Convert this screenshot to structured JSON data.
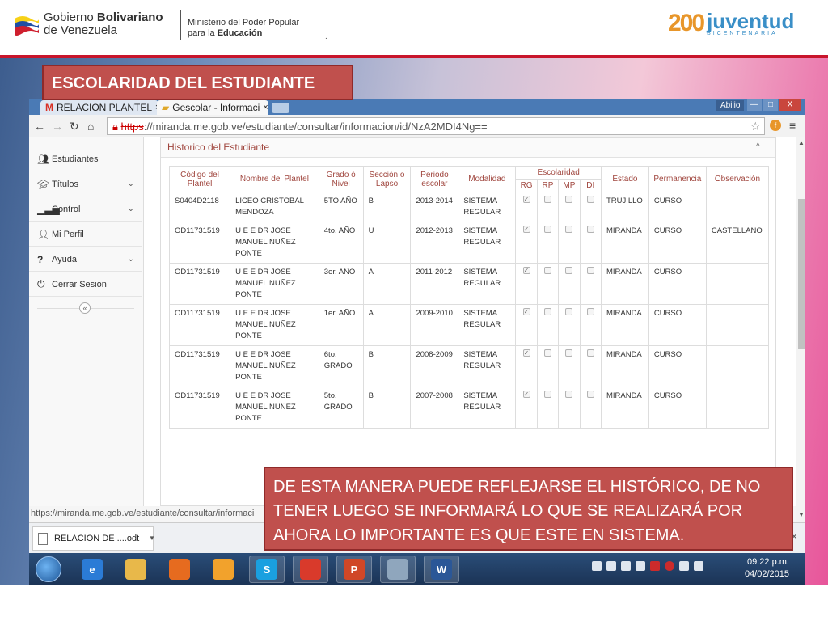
{
  "slide": {
    "title": "ESCOLARIDAD DEL ESTUDIANTE",
    "gov_title_bold": "Bolivariano",
    "gov_title_pre": "Gobierno",
    "gov_title_line2": "de Venezuela",
    "ministry_line1": "Ministerio  del Poder Popular",
    "ministry_line2_pre": "para la",
    "ministry_line2_bold": "Educación",
    "ministry_dot": ".",
    "youth_number": "200",
    "youth_word": "juventud",
    "youth_sub": "BICENTENARIA",
    "callout": "DE ESTA MANERA PUEDE REFLEJARSE EL HISTÓRICO, DE NO TENER LUEGO SE INFORMARÁ LO QUE SE REALIZARÁ POR AHORA LO IMPORTANTE ES QUE ESTE EN SISTEMA."
  },
  "browser": {
    "tabs": [
      {
        "label": "RELACION PLANTEL",
        "close": "×"
      },
      {
        "label": "Gescolar - Informaci",
        "close": "×"
      }
    ],
    "user": "Abilio",
    "window_buttons": [
      "—",
      "□",
      "X"
    ],
    "url_scheme": "https",
    "url_rest": "://miranda.me.gob.ve/estudiante/consultar/informacion/id/NzA2MDI4Ng==",
    "status_text": "https://miranda.me.gob.ve/estudiante/consultar/informaci",
    "download_file": "RELACION DE ....odt"
  },
  "sidebar": {
    "items": [
      {
        "label": "Estudiantes",
        "icon": "users-icon",
        "has_submenu": false
      },
      {
        "label": "Títulos",
        "icon": "graduation-cap-icon",
        "has_submenu": true
      },
      {
        "label": "Control",
        "icon": "signal-bars-icon",
        "has_submenu": true
      },
      {
        "label": "Mi Perfil",
        "icon": "user-icon",
        "has_submenu": false
      },
      {
        "label": "Ayuda",
        "icon": "question-icon",
        "has_submenu": true
      },
      {
        "label": "Cerrar Sesión",
        "icon": "power-icon",
        "has_submenu": false
      }
    ],
    "collapse_symbol": "«"
  },
  "panel": {
    "title": "Historico del Estudiante",
    "toggle": "^"
  },
  "table": {
    "headers": {
      "codigo": "Código del Plantel",
      "nombre": "Nombre del Plantel",
      "grado": "Grado ó Nivel",
      "seccion": "Sección o Lapso",
      "periodo": "Periodo escolar",
      "modalidad": "Modalidad",
      "escolaridad": "Escolaridad",
      "escolaridad_sub": [
        "RG",
        "RP",
        "MP",
        "DI"
      ],
      "estado": "Estado",
      "permanencia": "Permanencia",
      "observacion": "Observación"
    },
    "rows": [
      {
        "codigo": "S0404D2118",
        "nombre": "LICEO CRISTOBAL MENDOZA",
        "grado": "5TO AÑO",
        "seccion": "B",
        "periodo": "2013-2014",
        "modalidad": "SISTEMA REGULAR",
        "esc": [
          true,
          false,
          false,
          false
        ],
        "estado": "TRUJILLO",
        "permanencia": "CURSO",
        "observacion": ""
      },
      {
        "codigo": "OD11731519",
        "nombre": "U E E DR JOSE MANUEL NUÑEZ PONTE",
        "grado": "4to. AÑO",
        "seccion": "U",
        "periodo": "2012-2013",
        "modalidad": "SISTEMA REGULAR",
        "esc": [
          true,
          false,
          false,
          false
        ],
        "estado": "MIRANDA",
        "permanencia": "CURSO",
        "observacion": "CASTELLANO"
      },
      {
        "codigo": "OD11731519",
        "nombre": "U E E DR JOSE MANUEL NUÑEZ PONTE",
        "grado": "3er. AÑO",
        "seccion": "A",
        "periodo": "2011-2012",
        "modalidad": "SISTEMA REGULAR",
        "esc": [
          true,
          false,
          false,
          false
        ],
        "estado": "MIRANDA",
        "permanencia": "CURSO",
        "observacion": ""
      },
      {
        "codigo": "OD11731519",
        "nombre": "U E E DR JOSE MANUEL NUÑEZ PONTE",
        "grado": "1er. AÑO",
        "seccion": "A",
        "periodo": "2009-2010",
        "modalidad": "SISTEMA REGULAR",
        "esc": [
          true,
          false,
          false,
          false
        ],
        "estado": "MIRANDA",
        "permanencia": "CURSO",
        "observacion": ""
      },
      {
        "codigo": "OD11731519",
        "nombre": "U E E DR JOSE MANUEL NUÑEZ PONTE",
        "grado": "6to. GRADO",
        "seccion": "B",
        "periodo": "2008-2009",
        "modalidad": "SISTEMA REGULAR",
        "esc": [
          true,
          false,
          false,
          false
        ],
        "estado": "MIRANDA",
        "permanencia": "CURSO",
        "observacion": ""
      },
      {
        "codigo": "OD11731519",
        "nombre": "U E E DR JOSE MANUEL NUÑEZ PONTE",
        "grado": "5to. GRADO",
        "seccion": "B",
        "periodo": "2007-2008",
        "modalidad": "SISTEMA REGULAR",
        "esc": [
          true,
          false,
          false,
          false
        ],
        "estado": "MIRANDA",
        "permanencia": "CURSO",
        "observacion": ""
      }
    ]
  },
  "taskbar": {
    "apps": [
      {
        "name": "internet-explorer-icon",
        "glyph": "e",
        "color": "#2b7bd6"
      },
      {
        "name": "file-explorer-icon",
        "glyph": "",
        "color": "#e8b84a"
      },
      {
        "name": "firefox-icon",
        "glyph": "",
        "color": "#e66b1f"
      },
      {
        "name": "media-player-icon",
        "glyph": "",
        "color": "#f2a22c"
      },
      {
        "name": "skype-icon",
        "glyph": "S",
        "color": "#1aa0e0"
      },
      {
        "name": "chrome-icon",
        "glyph": "",
        "color": "#d93a2b"
      },
      {
        "name": "powerpoint-icon",
        "glyph": "P",
        "color": "#d04727"
      },
      {
        "name": "calculator-icon",
        "glyph": "",
        "color": "#8fa6bd"
      },
      {
        "name": "word-icon",
        "glyph": "W",
        "color": "#2b5797"
      }
    ],
    "time": "09:22 p.m.",
    "date": "04/02/2015"
  },
  "colors": {
    "accent_red": "#c0504d",
    "header_rule": "#c8152b",
    "table_header_text": "#a0463e"
  }
}
